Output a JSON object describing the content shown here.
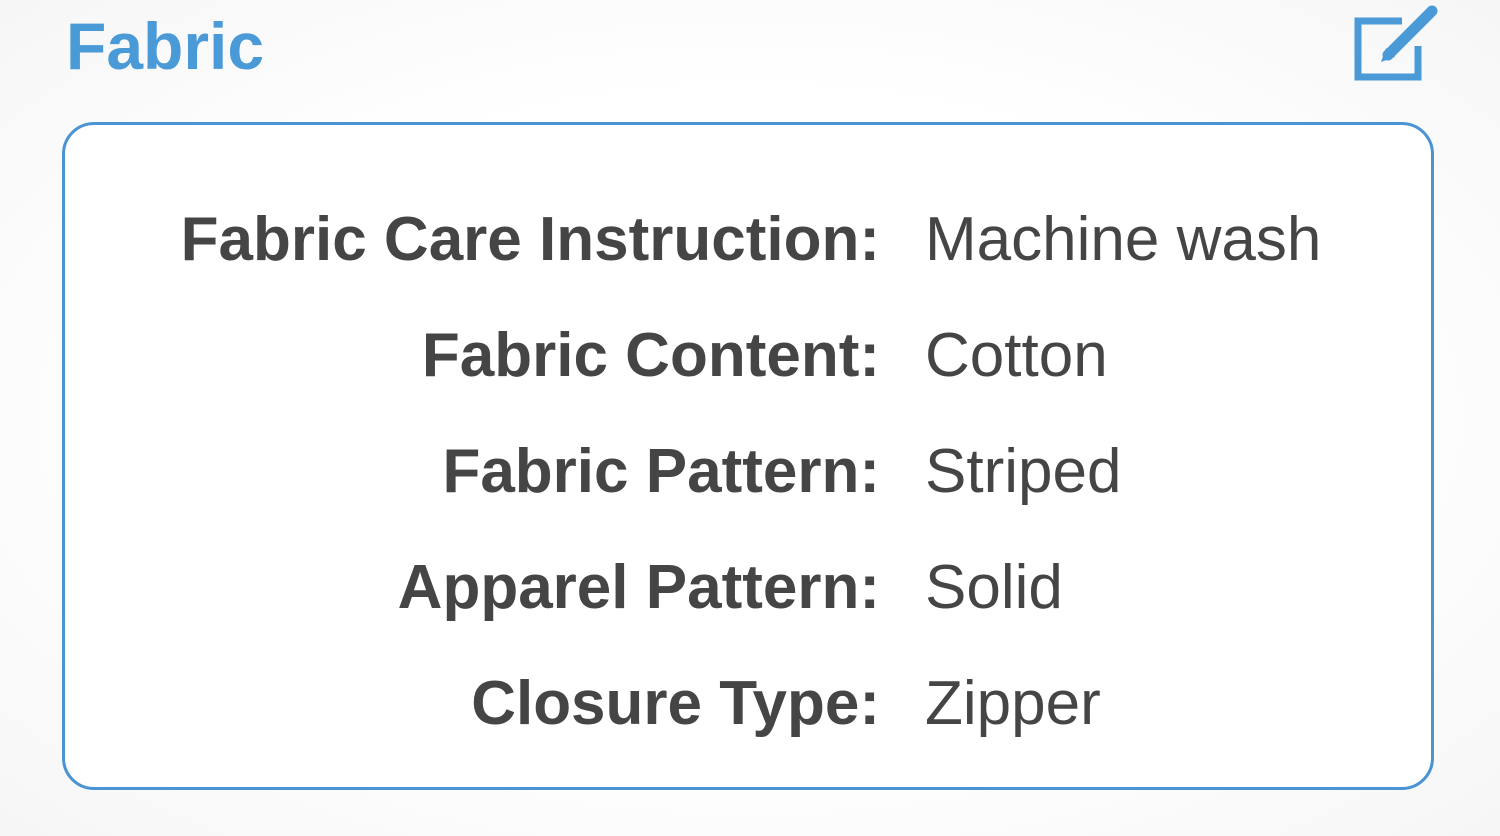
{
  "section": {
    "title": "Fabric",
    "edit_icon": "edit-icon"
  },
  "colors": {
    "accent": "#4a9ad8",
    "text": "#454545",
    "card_border": "#4a94d3"
  },
  "attributes": [
    {
      "label": "Fabric Care Instruction:",
      "value": "Machine wash"
    },
    {
      "label": "Fabric Content:",
      "value": "Cotton"
    },
    {
      "label": "Fabric Pattern:",
      "value": "Striped"
    },
    {
      "label": "Apparel Pattern:",
      "value": "Solid"
    },
    {
      "label": "Closure Type:",
      "value": "Zipper"
    }
  ]
}
